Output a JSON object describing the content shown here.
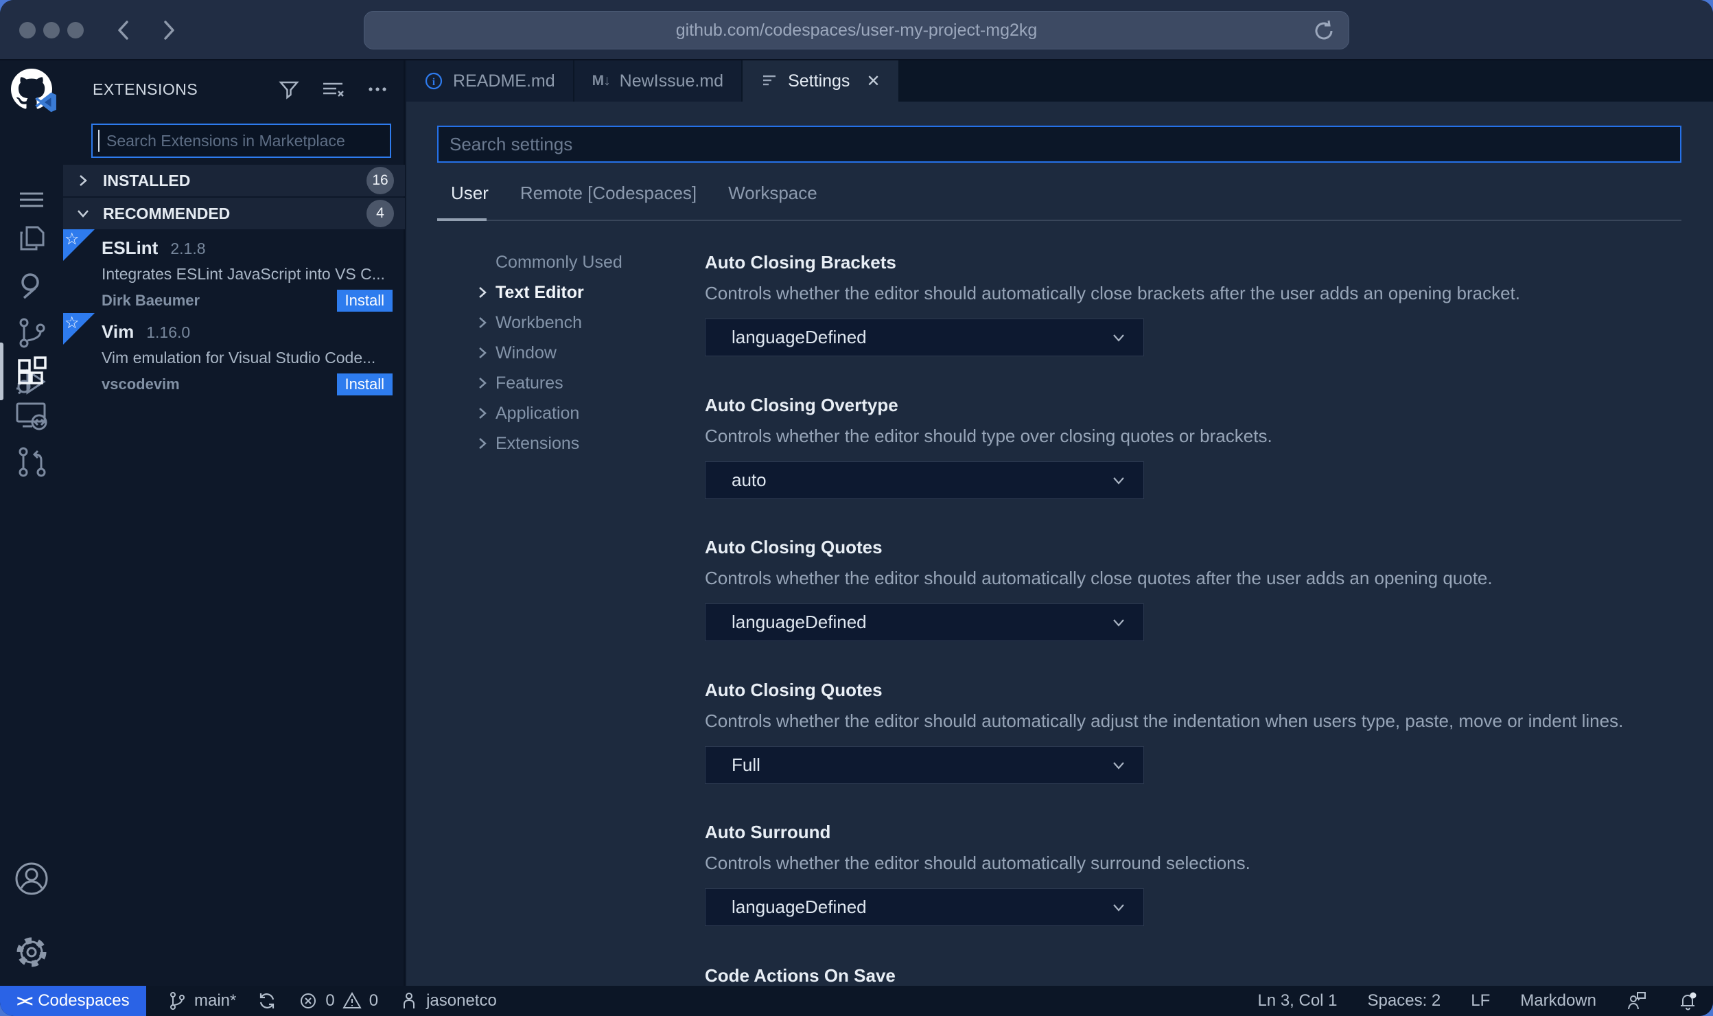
{
  "browser": {
    "url": "github.com/codespaces/user-my-project-mg2kg"
  },
  "activity_bar": {
    "icons": [
      "github-codespaces-logo",
      "menu-icon",
      "explorer-icon",
      "search-icon",
      "source-control-icon",
      "run-debug-icon",
      "extensions-icon",
      "remote-explorer-icon",
      "pull-request-icon",
      "account-icon",
      "settings-gear-icon"
    ],
    "active": "extensions-icon"
  },
  "sidebar": {
    "title": "EXTENSIONS",
    "search_placeholder": "Search Extensions in Marketplace",
    "sections": [
      {
        "label": "INSTALLED",
        "count": "16"
      },
      {
        "label": "RECOMMENDED",
        "count": "4"
      }
    ],
    "extensions": [
      {
        "name": "ESLint",
        "version": "2.1.8",
        "description": "Integrates ESLint JavaScript into VS C...",
        "author": "Dirk Baeumer",
        "action": "Install"
      },
      {
        "name": "Vim",
        "version": "1.16.0",
        "description": "Vim emulation for Visual Studio Code...",
        "author": "vscodevim",
        "action": "Install"
      }
    ]
  },
  "editor_tabs": [
    {
      "label": "README.md"
    },
    {
      "label": "NewIssue.md"
    },
    {
      "label": "Settings"
    }
  ],
  "settings_page": {
    "search_placeholder": "Search settings",
    "scopes": [
      {
        "label": "User"
      },
      {
        "label": "Remote [Codespaces]"
      },
      {
        "label": "Workspace"
      }
    ],
    "toc": [
      {
        "label": "Commonly Used"
      },
      {
        "label": "Text Editor"
      },
      {
        "label": "Workbench"
      },
      {
        "label": "Window"
      },
      {
        "label": "Features"
      },
      {
        "label": "Application"
      },
      {
        "label": "Extensions"
      }
    ],
    "items": [
      {
        "title": "Auto Closing Brackets",
        "description": "Controls whether the editor should automatically close brackets after the user adds an opening bracket.",
        "value": "languageDefined"
      },
      {
        "title": "Auto Closing Overtype",
        "description": "Controls whether the editor should type over closing quotes or brackets.",
        "value": "auto"
      },
      {
        "title": "Auto Closing Quotes",
        "description": "Controls whether the editor should automatically close quotes after the user adds an opening quote.",
        "value": "languageDefined"
      },
      {
        "title": "Auto Closing Quotes",
        "description": "Controls whether the editor should automatically adjust the indentation when users type, paste, move or indent lines.",
        "value": "Full"
      },
      {
        "title": "Auto Surround",
        "description": "Controls whether the editor should automatically surround selections.",
        "value": "languageDefined"
      },
      {
        "title": "Code Actions On Save"
      }
    ]
  },
  "status_bar": {
    "remote_label": "Codespaces",
    "branch": "main*",
    "errors": "0",
    "warnings": "0",
    "user": "jasonetco",
    "cursor_position": "Ln 3, Col 1",
    "indentation": "Spaces: 2",
    "eol": "LF",
    "language": "Markdown"
  },
  "colors": {
    "accent_blue": "#2e7cee",
    "remote_badge_bg": "#2a63e6",
    "editor_bg": "#1d2a3e",
    "panel_bg": "#0e1829",
    "chrome_bg": "#212d44"
  }
}
